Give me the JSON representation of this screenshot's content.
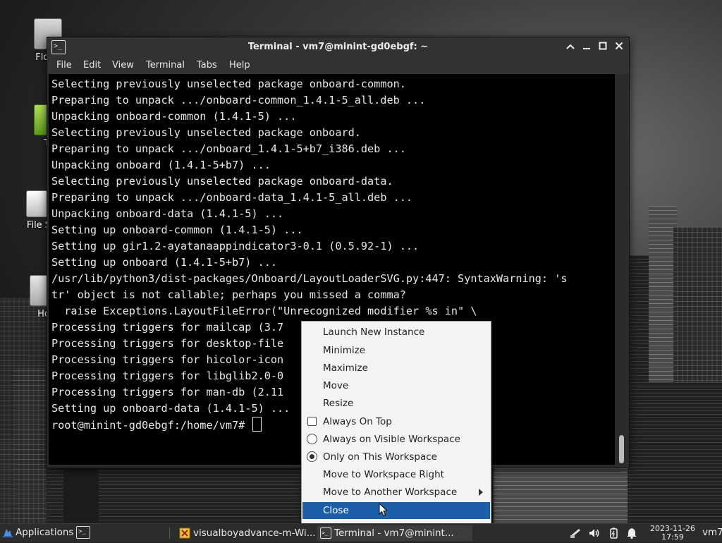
{
  "desktop": {
    "icons": [
      {
        "label": "Flopp"
      },
      {
        "label": "Tr"
      },
      {
        "label": "File S"
      },
      {
        "label": "Ho"
      }
    ]
  },
  "window": {
    "title": "Terminal - vm7@minint-gd0ebgf: ~",
    "controls": {
      "shade": "^",
      "minimize": "_",
      "maximize": "□",
      "close": "✕"
    },
    "menus": [
      "File",
      "Edit",
      "View",
      "Terminal",
      "Tabs",
      "Help"
    ]
  },
  "terminal": {
    "lines": [
      "Selecting previously unselected package onboard-common.",
      "Preparing to unpack .../onboard-common_1.4.1-5_all.deb ...",
      "Unpacking onboard-common (1.4.1-5) ...",
      "Selecting previously unselected package onboard.",
      "Preparing to unpack .../onboard_1.4.1-5+b7_i386.deb ...",
      "Unpacking onboard (1.4.1-5+b7) ...",
      "Selecting previously unselected package onboard-data.",
      "Preparing to unpack .../onboard-data_1.4.1-5_all.deb ...",
      "Unpacking onboard-data (1.4.1-5) ...",
      "Setting up onboard-common (1.4.1-5) ...",
      "Setting up gir1.2-ayatanaappindicator3-0.1 (0.5.92-1) ...",
      "Setting up onboard (1.4.1-5+b7) ...",
      "/usr/lib/python3/dist-packages/Onboard/LayoutLoaderSVG.py:447: SyntaxWarning: 's",
      "tr' object is not callable; perhaps you missed a comma?",
      "  raise Exceptions.LayoutFileError(\"Unrecognized modifier %s in\" \\",
      "Processing triggers for mailcap (3.7",
      "Processing triggers for desktop-file",
      "Processing triggers for hicolor-icon",
      "Processing triggers for libglib2.0-0",
      "Processing triggers for man-db (2.11",
      "Setting up onboard-data (1.4.1-5) ..."
    ],
    "prompt": "root@minint-gd0ebgf:/home/vm7# "
  },
  "context_menu": {
    "items": [
      {
        "label": "Launch New Instance"
      },
      {
        "label": "Minimize"
      },
      {
        "label": "Maximize"
      },
      {
        "label": "Move"
      },
      {
        "label": "Resize"
      },
      {
        "label": "Always On Top"
      },
      {
        "label": "Always on Visible Workspace"
      },
      {
        "label": "Only on This Workspace"
      },
      {
        "label": "Move to Workspace Right"
      },
      {
        "label": "Move to Another Workspace"
      },
      {
        "label": "Close"
      }
    ],
    "checked_option": "Only on This Workspace",
    "highlighted_item": "Close",
    "highlight_color": "#1c5ea8"
  },
  "taskbar": {
    "applications_label": "Applications",
    "tasks": [
      {
        "label": "visualboyadvance-m-Wi...",
        "icon": "vba-icon"
      },
      {
        "label": "Terminal - vm7@minint...",
        "icon": "terminal-icon",
        "active": true
      }
    ],
    "clock": {
      "date": "2023-11-26",
      "time": "17:59"
    },
    "user": "vm7"
  }
}
